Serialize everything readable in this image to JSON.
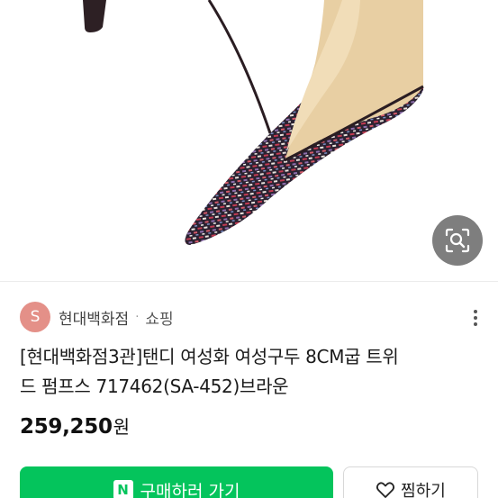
{
  "product_image": {
    "icon": "tweed-pump-shoe-photo"
  },
  "lens_button": {
    "icon": "image-search-icon"
  },
  "seller": {
    "avatar_letter": "S",
    "name": "현대백화점",
    "separator": "·",
    "category": "쇼핑"
  },
  "more_menu": {
    "icon": "more-vertical-icon"
  },
  "product": {
    "title_line1": "[현대백화점3관]탠디 여성화 여성구두 8CM굽 트위",
    "title_line2": "드 펌프스 717462(SA-452)브라운",
    "price": "259,250",
    "price_unit": "원"
  },
  "actions": {
    "buy_logo": "N",
    "buy_label": "구매하러 가기",
    "wish_label": "찜하기",
    "wish_icon": "heart-link-icon"
  },
  "colors": {
    "buy_green": "#04c45c",
    "avatar": "#e49088"
  }
}
